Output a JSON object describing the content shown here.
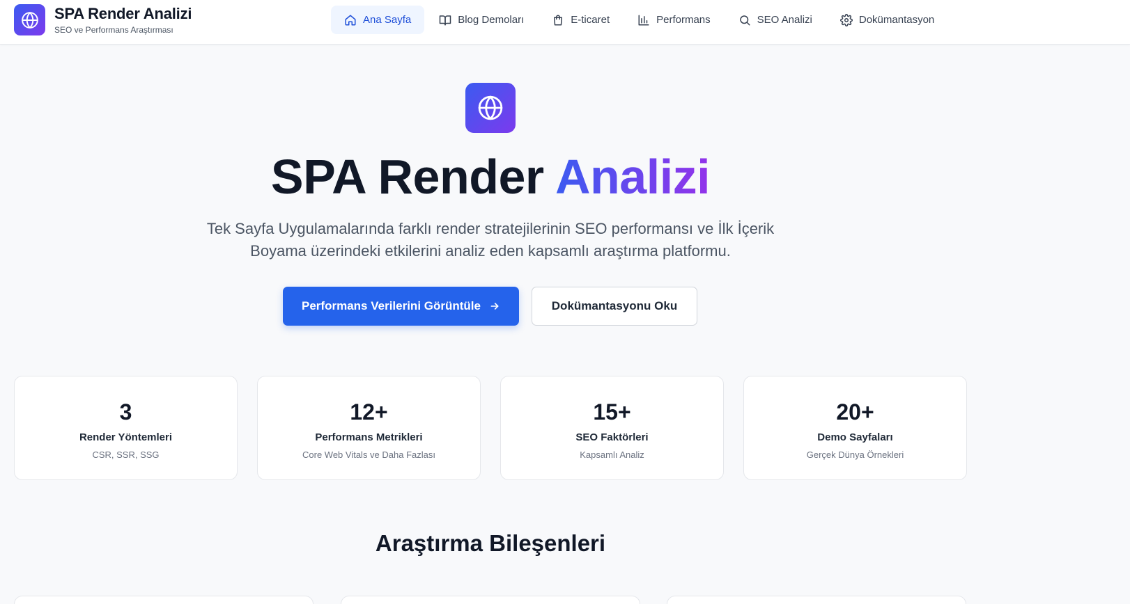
{
  "header": {
    "brand_title": "SPA Render Analizi",
    "brand_subtitle": "SEO ve Performans Araştırması",
    "nav": [
      {
        "label": "Ana Sayfa",
        "icon": "home-icon",
        "active": true
      },
      {
        "label": "Blog Demoları",
        "icon": "book-icon",
        "active": false
      },
      {
        "label": "E-ticaret",
        "icon": "shopping-bag-icon",
        "active": false
      },
      {
        "label": "Performans",
        "icon": "bar-chart-icon",
        "active": false
      },
      {
        "label": "SEO Analizi",
        "icon": "search-icon",
        "active": false
      },
      {
        "label": "Dokümantasyon",
        "icon": "gear-icon",
        "active": false
      }
    ]
  },
  "hero": {
    "icon": "globe-icon",
    "title_main": "SPA Render ",
    "title_accent": "Analizi",
    "description": "Tek Sayfa Uygulamalarında farklı render stratejilerinin SEO performansı ve İlk İçerik Boyama üzerindeki etkilerini analiz eden kapsamlı araştırma platformu.",
    "primary_button": "Performans Verilerini Görüntüle",
    "secondary_button": "Dokümantasyonu Oku"
  },
  "stats": [
    {
      "value": "3",
      "label": "Render Yöntemleri",
      "sub": "CSR, SSR, SSG"
    },
    {
      "value": "12+",
      "label": "Performans Metrikleri",
      "sub": "Core Web Vitals ve Daha Fazlası"
    },
    {
      "value": "15+",
      "label": "SEO Faktörleri",
      "sub": "Kapsamlı Analiz"
    },
    {
      "value": "20+",
      "label": "Demo Sayfaları",
      "sub": "Gerçek Dünya Örnekleri"
    }
  ],
  "section": {
    "title": "Araştırma Bileşenleri"
  },
  "colors": {
    "accent": "#2563eb",
    "gradient_start": "#3b5bf0",
    "gradient_end": "#7c3aed",
    "background": "#f8f9fb"
  }
}
